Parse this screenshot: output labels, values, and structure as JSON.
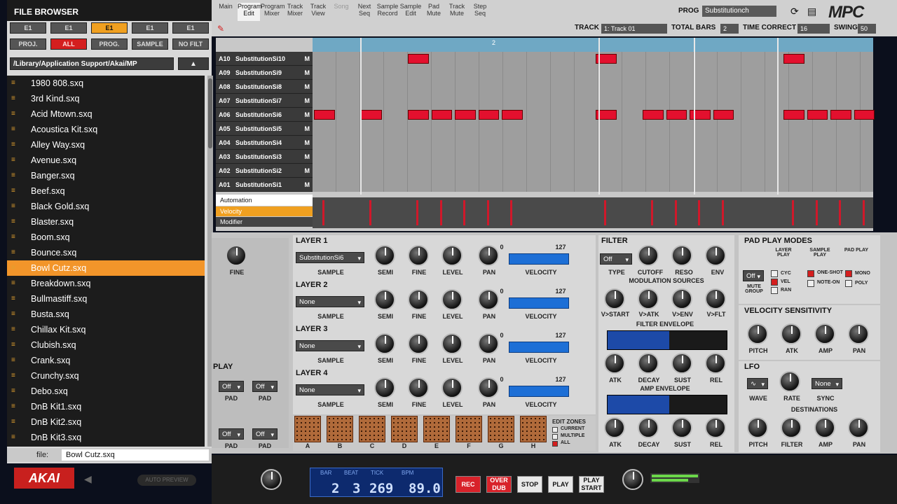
{
  "browser": {
    "title": "FILE BROWSER",
    "drive_buttons": [
      "E1",
      "E1",
      "E1",
      "E1",
      "E1"
    ],
    "type_buttons": [
      "PROJ.",
      "ALL",
      "PROG.",
      "SAMPLE",
      "NO FILT"
    ],
    "path": "/Library/Application Support/Akai/MP",
    "up_button": "▲",
    "files": [
      "1980 808.sxq",
      "3rd Kind.sxq",
      "Acid Mtown.sxq",
      "Acoustica Kit.sxq",
      "Alley Way.sxq",
      "Avenue.sxq",
      "Banger.sxq",
      "Beef.sxq",
      "Black Gold.sxq",
      "Blaster.sxq",
      "Boom.sxq",
      "Bounce.sxq",
      "Bowl Cutz.sxq",
      "Breakdown.sxq",
      "Bullmastiff.sxq",
      "Busta.sxq",
      "Chillax Kit.sxq",
      "Clubish.sxq",
      "Crank.sxq",
      "Crunchy.sxq",
      "Debo.sxq",
      "DnB Kit1.sxq",
      "DnB Kit2.sxq",
      "DnB Kit3.sxq"
    ],
    "selected_file": "Bowl Cutz.sxq",
    "file_label": "file:",
    "file_value": "Bowl Cutz.sxq"
  },
  "tabs": [
    {
      "label": "Main",
      "active": false
    },
    {
      "label": "Program Edit",
      "active": true
    },
    {
      "label": "Program Mixer",
      "active": false
    },
    {
      "label": "Track Mixer",
      "active": false
    },
    {
      "label": "Track View",
      "active": false
    },
    {
      "label": "Song",
      "active": false
    },
    {
      "label": "Next Seq",
      "active": false
    },
    {
      "label": "Sample Record",
      "active": false
    },
    {
      "label": "Sample Edit",
      "active": false
    },
    {
      "label": "Pad Mute",
      "active": false
    },
    {
      "label": "Track Mute",
      "active": false
    },
    {
      "label": "Step Seq",
      "active": false
    }
  ],
  "header": {
    "prog_label": "PROG",
    "prog_value": "Substitutionch",
    "logo": "MPC",
    "track_label": "TRACK",
    "track_value": "1: Track 01",
    "total_bars_label": "TOTAL BARS",
    "total_bars_value": "2",
    "time_correct_label": "TIME CORRECT",
    "time_correct_value": "16",
    "swing_label": "SWING",
    "swing_value": "50"
  },
  "grid": {
    "ruler_marker": "2",
    "rows": [
      {
        "id": "A10",
        "name": "SubstitutionSi10",
        "mute": "M",
        "hits": [
          4
        ]
      },
      {
        "id": "A09",
        "name": "SubstitutionSi9",
        "mute": "M",
        "hits": []
      },
      {
        "id": "A08",
        "name": "SubstitutionSi8",
        "mute": "M",
        "hits": []
      },
      {
        "id": "A07",
        "name": "SubstitutionSi7",
        "mute": "M",
        "hits": []
      },
      {
        "id": "A06",
        "name": "SubstitutionSi6",
        "mute": "M",
        "hits": [
          0,
          2,
          4,
          5,
          6,
          7,
          8
        ]
      },
      {
        "id": "A05",
        "name": "SubstitutionSi5",
        "mute": "M",
        "hits": []
      },
      {
        "id": "A04",
        "name": "SubstitutionSi4",
        "mute": "M",
        "hits": []
      },
      {
        "id": "A03",
        "name": "SubstitutionSi3",
        "mute": "M",
        "hits": []
      },
      {
        "id": "A02",
        "name": "SubstitutionSi2",
        "mute": "M",
        "hits": []
      },
      {
        "id": "A01",
        "name": "SubstitutionSi1",
        "mute": "M",
        "hits": []
      }
    ],
    "automation_label": "Automation",
    "velocity_label": "Velocity",
    "modifier_label": "Modifier"
  },
  "layers": [
    {
      "title": "LAYER 1",
      "sample": "SubstitutionSi6"
    },
    {
      "title": "LAYER 2",
      "sample": "None"
    },
    {
      "title": "LAYER 3",
      "sample": "None"
    },
    {
      "title": "LAYER 4",
      "sample": "None"
    }
  ],
  "layer_labels": {
    "sample": "SAMPLE",
    "semi": "SEMI",
    "fine": "FINE",
    "level": "LEVEL",
    "pan": "PAN",
    "velocity": "VELOCITY",
    "vmin": "0",
    "vmax": "127"
  },
  "left_small": {
    "fine": "FINE",
    "play": "PLAY",
    "off": "Off",
    "pad": "PAD"
  },
  "edit_zones": {
    "title": "EDIT ZONES",
    "opts": [
      "CURRENT",
      "MULTIPLE",
      "ALL"
    ]
  },
  "pads": [
    "A",
    "B",
    "C",
    "D",
    "E",
    "F",
    "G",
    "H"
  ],
  "filter": {
    "title": "FILTER",
    "type": "Off",
    "labels": [
      "TYPE",
      "CUTOFF",
      "RESO",
      "ENV"
    ],
    "mod_title": "MODULATION SOURCES",
    "mod_labels": [
      "V>START",
      "V>ATK",
      "V>ENV",
      "V>FLT"
    ],
    "fenv_title": "FILTER ENVELOPE",
    "env_labels": [
      "ATK",
      "DECAY",
      "SUST",
      "REL"
    ],
    "aenv_title": "AMP ENVELOPE"
  },
  "pad_play": {
    "title": "PAD PLAY MODES",
    "col_labels": [
      "LAYER PLAY",
      "SAMPLE PLAY",
      "PAD PLAY"
    ],
    "mute_value": "Off",
    "mute_label": "MUTE GROUP",
    "layer_opts": [
      "CYC",
      "VEL",
      "RAN"
    ],
    "sample_opts": [
      "ONE-SHOT",
      "NOTE-ON"
    ],
    "pad_opts": [
      "MONO",
      "POLY"
    ]
  },
  "vel_sens": {
    "title": "VELOCITY SENSITIVITY",
    "labels": [
      "PITCH",
      "ATK",
      "AMP",
      "PAN"
    ]
  },
  "lfo": {
    "title": "LFO",
    "labels": [
      "WAVE",
      "RATE",
      "SYNC"
    ],
    "sync_value": "None",
    "dest_title": "DESTINATIONS",
    "dest_labels": [
      "PITCH",
      "FILTER",
      "AMP",
      "PAN"
    ]
  },
  "transport": {
    "brand": "AKAI",
    "auto_preview": "AUTO PREVIEW",
    "bar_label": "BAR",
    "beat_label": "BEAT",
    "tick_label": "TICK",
    "bpm_label": "BPM",
    "bar": "2",
    "beat": "3",
    "tick": "269",
    "bpm": "89.0",
    "rec": "REC",
    "overdub": "OVER DUB",
    "stop": "STOP",
    "play": "PLAY",
    "play_start": "PLAY START"
  },
  "colors": {
    "accent": "#f2952a",
    "hit": "#e3102e",
    "velocity": "#1d6fd6"
  }
}
